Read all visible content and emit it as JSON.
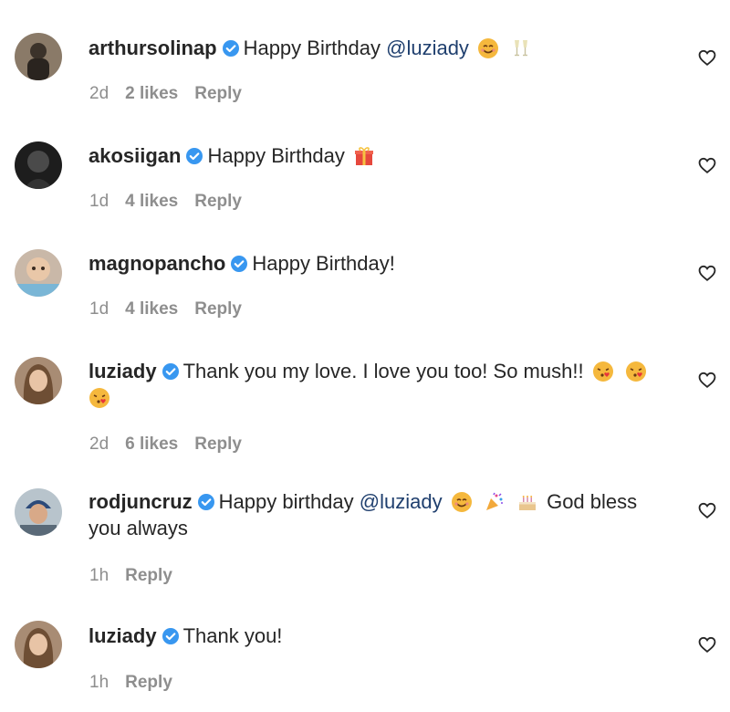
{
  "comments": [
    {
      "username": "arthursolinap",
      "text_before": "Happy Birthday ",
      "mention": "@luziady",
      "text_after": "",
      "line2": "",
      "emojis_inline": [
        "smiling-face-emoji",
        "champagne-glasses-emoji"
      ],
      "time": "2d",
      "likes": "2 likes",
      "reply": "Reply"
    },
    {
      "username": "akosiigan",
      "text_before": "Happy Birthday ",
      "mention": "",
      "text_after": "",
      "line2": "",
      "emojis_inline": [
        "wrapped-gift-emoji"
      ],
      "time": "1d",
      "likes": "4 likes",
      "reply": "Reply"
    },
    {
      "username": "magnopancho",
      "text_before": "Happy Birthday!",
      "mention": "",
      "text_after": "",
      "line2": "",
      "emojis_inline": [],
      "time": "1d",
      "likes": "4 likes",
      "reply": "Reply"
    },
    {
      "username": "luziady",
      "text_before": "Thank you my love. I love you too! So mush!! ",
      "mention": "",
      "text_after": "",
      "line2": "",
      "emojis_inline": [
        "face-blowing-kiss-emoji",
        "face-blowing-kiss-emoji",
        "face-blowing-kiss-emoji"
      ],
      "time": "2d",
      "likes": "6 likes",
      "reply": "Reply"
    },
    {
      "username": "rodjuncruz",
      "text_before": "Happy birthday ",
      "mention": "@luziady",
      "text_after": " God bless",
      "line2": "you always",
      "emojis_inline": [
        "smiling-face-emoji",
        "party-popper-emoji",
        "birthday-cake-emoji"
      ],
      "time": "1h",
      "likes": "",
      "reply": "Reply"
    },
    {
      "username": "luziady",
      "text_before": "Thank you!",
      "mention": "",
      "text_after": "",
      "line2": "",
      "emojis_inline": [],
      "time": "1h",
      "likes": "",
      "reply": "Reply"
    }
  ],
  "colors": {
    "verified": "#3897f0",
    "meta_gray": "#8e8e8e",
    "mention": "#1f3f6e"
  },
  "icons": {
    "like": "heart-outline-icon",
    "verified": "verified-badge-icon"
  }
}
